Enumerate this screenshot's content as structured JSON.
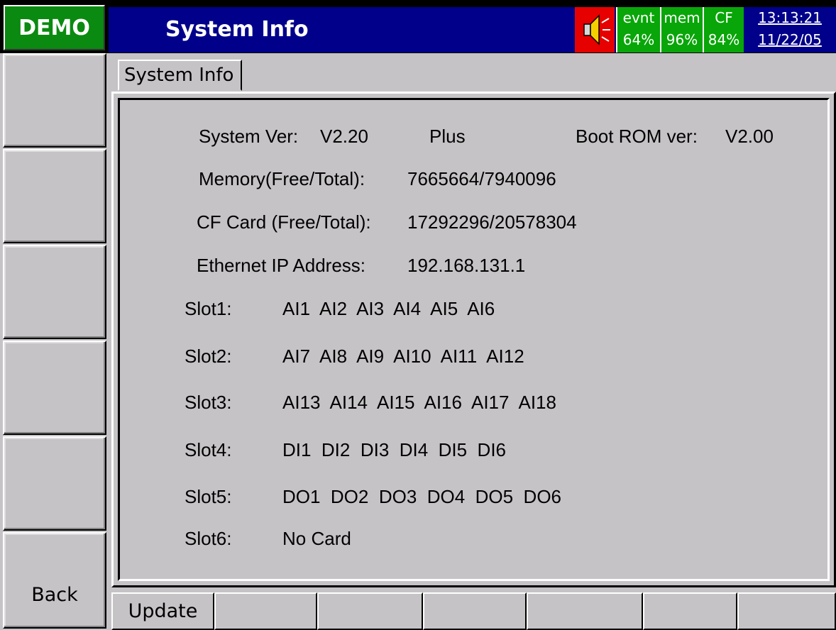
{
  "header": {
    "demo_label": "DEMO",
    "title": "System Info",
    "status": {
      "evnt_label": "evnt",
      "evnt_value": "64%",
      "mem_label": "mem",
      "mem_value": "96%",
      "cf_label": "CF",
      "cf_value": "84%"
    },
    "time": "13:13:21",
    "date": "11/22/05",
    "speaker_icon": "speaker-alarm-icon"
  },
  "sidekeys": [
    "",
    "",
    "",
    "",
    "",
    "Back"
  ],
  "tab": {
    "label": "System Info"
  },
  "info": {
    "system_ver_label": "System Ver:",
    "system_ver_value": "V2.20",
    "edition": "Plus",
    "boot_rom_label": "Boot ROM ver:",
    "boot_rom_value": "V2.00",
    "memory_label": "Memory(Free/Total):",
    "memory_value": "7665664/7940096",
    "cf_label": "CF Card (Free/Total):",
    "cf_value": "17292296/20578304",
    "ip_label": "Ethernet IP Address:",
    "ip_value": "192.168.131.1"
  },
  "slots": [
    {
      "label": "Slot1:",
      "value": "AI1  AI2  AI3  AI4  AI5  AI6"
    },
    {
      "label": "Slot2:",
      "value": "AI7  AI8  AI9  AI10  AI11  AI12"
    },
    {
      "label": "Slot3:",
      "value": "AI13  AI14  AI15  AI16  AI17  AI18"
    },
    {
      "label": "Slot4:",
      "value": "DI1  DI2  DI3  DI4  DI5  DI6"
    },
    {
      "label": "Slot5:",
      "value": "DO1  DO2  DO3  DO4  DO5  DO6"
    },
    {
      "label": "Slot6:",
      "value": "No Card"
    }
  ],
  "fkeys": [
    "Update",
    "",
    "",
    "",
    "",
    "",
    ""
  ],
  "colors": {
    "title_bar": "#00008a",
    "demo": "#0a8a10",
    "status": "#08a608",
    "alarm": "#e60000",
    "face": "#c6c3c6"
  }
}
